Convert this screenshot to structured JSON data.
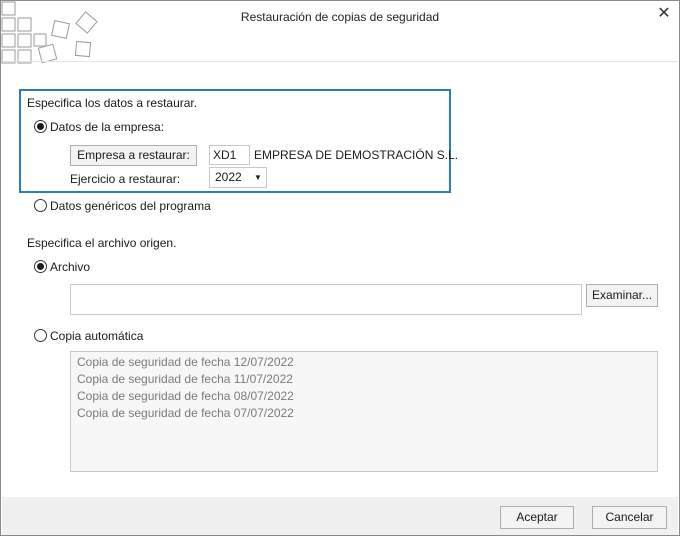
{
  "dialog": {
    "title": "Restauración de copias de seguridad",
    "close_glyph": "✕"
  },
  "restore_section": {
    "heading": "Especifica los datos a restaurar.",
    "company_option_label": "Datos de la empresa:",
    "company_option_selected": true,
    "company_button_label": "Empresa a restaurar:",
    "company_code": "XD1",
    "company_name": "EMPRESA DE DEMOSTRACIÓN S.L.",
    "year_label": "Ejercicio a restaurar:",
    "year_value": "2022",
    "generic_option_label": "Datos genéricos del programa",
    "generic_option_selected": false
  },
  "source_section": {
    "heading": "Especifica el archivo origen.",
    "file_option_label": "Archivo",
    "file_option_selected": true,
    "file_path": "",
    "browse_button_label": "Examinar...",
    "auto_option_label": "Copia automática",
    "auto_option_selected": false,
    "backups": [
      "Copia de seguridad de fecha 12/07/2022",
      "Copia de seguridad de fecha 11/07/2022",
      "Copia de seguridad de fecha 08/07/2022",
      "Copia de seguridad de fecha 07/07/2022"
    ]
  },
  "footer": {
    "accept_label": "Aceptar",
    "cancel_label": "Cancelar"
  },
  "colors": {
    "group_border": "#2b7bbf",
    "disabled_text": "#7a7a7a"
  },
  "icons": {
    "logo": "tiled-squares-logo",
    "close": "close-icon",
    "combo": "chevron-down-icon"
  }
}
